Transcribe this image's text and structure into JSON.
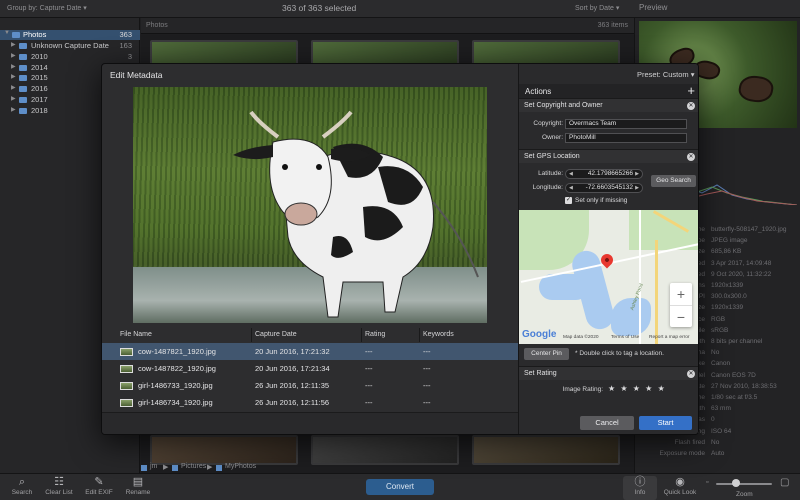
{
  "topbar": {
    "group_by": "Group by: Capture Date ▾",
    "selection": "363 of 363 selected",
    "sort_by": "Sort by Date ▾",
    "preview_title": "Preview"
  },
  "sidebar": {
    "items": [
      {
        "label": "Photos",
        "count": "363"
      },
      {
        "label": "Unknown Capture Date",
        "count": "163"
      },
      {
        "label": "2010",
        "count": "3"
      },
      {
        "label": "2014",
        "count": "1"
      },
      {
        "label": "2015",
        "count": "1"
      },
      {
        "label": "2016",
        "count": "1"
      },
      {
        "label": "2017",
        "count": "1"
      },
      {
        "label": "2018",
        "count": "1"
      }
    ]
  },
  "grid": {
    "header_left": "Photos",
    "header_right": "363 items"
  },
  "path": {
    "seg1": "jm",
    "seg2": "Pictures",
    "seg3": "MyPhotos"
  },
  "info_panel": {
    "rows": [
      {
        "key": "File name",
        "value": "butterfly-508147_1920.jpg"
      },
      {
        "key": "File type",
        "value": "JPEG image"
      },
      {
        "key": "File size",
        "value": "685,86 KB"
      },
      {
        "key": "Created",
        "value": "3 Apr 2017, 14:09:48"
      },
      {
        "key": "Modified",
        "value": "9 Oct 2020, 11:32:22"
      },
      {
        "key": "Dimensions",
        "value": "1920x1339"
      },
      {
        "key": "DPI",
        "value": "300.0x300.0"
      },
      {
        "key": "Size",
        "value": "1920x1339"
      },
      {
        "key": "Color space",
        "value": "RGB"
      },
      {
        "key": "Color profile",
        "value": "sRGB"
      },
      {
        "key": "Depth",
        "value": "8 bits per channel"
      },
      {
        "key": "Alpha",
        "value": "No"
      },
      {
        "key": "Make",
        "value": "Canon"
      },
      {
        "key": "Model",
        "value": "Canon EOS 7D"
      },
      {
        "key": "Capture date",
        "value": "27 Nov 2010, 18:38:53"
      },
      {
        "key": "Exposure time",
        "value": "1/80 sec at f/3.5"
      },
      {
        "key": "Focal length",
        "value": "63 mm"
      },
      {
        "key": "Exposure bias",
        "value": "0"
      },
      {
        "key": "ISO speed rating",
        "value": "ISO 64"
      },
      {
        "key": "Flash fired",
        "value": "No"
      },
      {
        "key": "Exposure mode",
        "value": "Auto"
      }
    ]
  },
  "bottombar": {
    "search": "Search",
    "clear_list": "Clear List",
    "edit_exif": "Edit EXIF",
    "rename": "Rename",
    "convert": "Convert",
    "info": "Info",
    "quick_look": "Quick Look",
    "zoom": "Zoom"
  },
  "modal": {
    "title": "Edit Metadata",
    "preset": "Preset: Custom ▾",
    "table": {
      "headers": [
        "File Name",
        "Capture Date",
        "Rating",
        "Keywords"
      ],
      "rows": [
        {
          "name": "cow-1487821_1920.jpg",
          "date": "20 Jun 2016, 17:21:32",
          "rating": "---",
          "keywords": "---"
        },
        {
          "name": "cow-1487822_1920.jpg",
          "date": "20 Jun 2016, 17:21:34",
          "rating": "---",
          "keywords": "---"
        },
        {
          "name": "girl-1486733_1920.jpg",
          "date": "26 Jun 2016, 12:11:35",
          "rating": "---",
          "keywords": "---"
        },
        {
          "name": "girl-1486734_1920.jpg",
          "date": "26 Jun 2016, 12:11:56",
          "rating": "---",
          "keywords": "---"
        }
      ]
    },
    "actions": {
      "title": "Actions",
      "copyright_section": "Set Copyright and Owner",
      "copyright_label": "Copyright:",
      "copyright_value": "Overmacs Team",
      "owner_label": "Owner:",
      "owner_value": "PhotoMill",
      "gps_section": "Set GPS Location",
      "latitude_label": "Latitude:",
      "latitude_value": "42.1798665266",
      "longitude_label": "Longitude:",
      "longitude_value": "-72.6603545132",
      "geo_search": "Geo Search",
      "only_if_missing": "Set only if missing",
      "center_pin": "Center Pin",
      "pin_hint": "* Double click to tag a location.",
      "rating_section": "Set Rating",
      "image_rating_label": "Image Rating:",
      "stars": "★ ★ ★ ★ ★",
      "map": {
        "google": "Google",
        "map_data": "Map data ©2020",
        "terms": "Terms of Use",
        "report": "Report a map error",
        "zoom_in": "+",
        "zoom_out": "−"
      }
    },
    "cancel": "Cancel",
    "start": "Start"
  }
}
